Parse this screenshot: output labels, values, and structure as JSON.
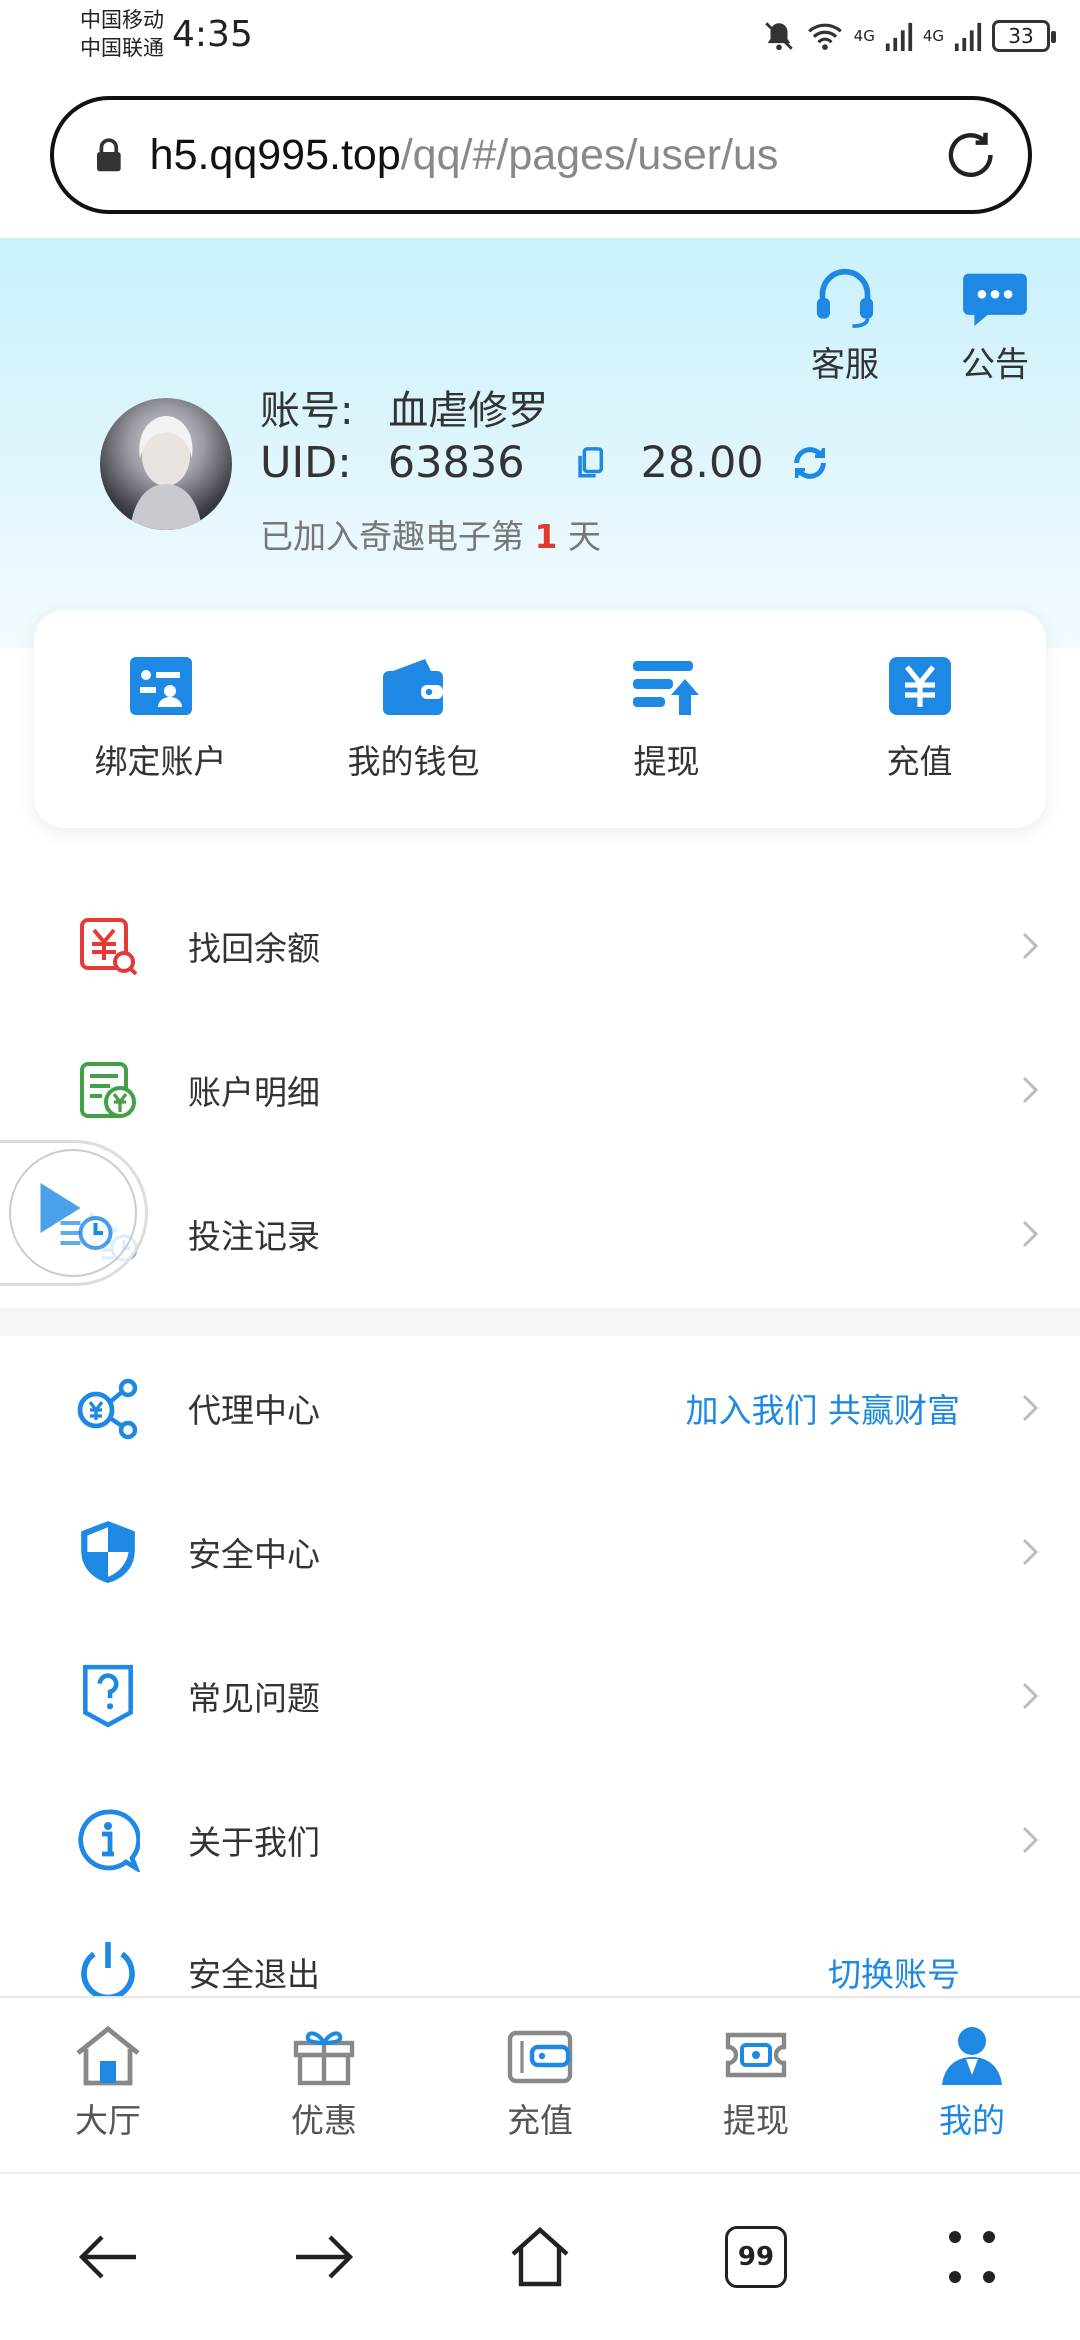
{
  "status_bar": {
    "carrier1": "中国移动",
    "carrier2": "中国联通",
    "time": "4:35",
    "signal1": "4G",
    "signal2": "4G",
    "battery": "33"
  },
  "browser": {
    "url_host": "h5.qq995.top",
    "url_path": "/qq/#/pages/user/us"
  },
  "header": {
    "service_label": "客服",
    "notice_label": "公告",
    "account_label": "账号:",
    "account_name": "血虐修罗",
    "uid_label": "UID:",
    "uid_value": "63836",
    "balance": "28.00",
    "joined_prefix": "已加入奇趣电子第",
    "joined_days": "1",
    "joined_suffix": "天"
  },
  "quick_actions": [
    {
      "label": "绑定账户",
      "icon": "bind-account-icon"
    },
    {
      "label": "我的钱包",
      "icon": "wallet-icon"
    },
    {
      "label": "提现",
      "icon": "withdraw-icon"
    },
    {
      "label": "充值",
      "icon": "recharge-icon"
    }
  ],
  "menu": [
    {
      "label": "找回余额",
      "icon": "recover-balance-icon",
      "extra": ""
    },
    {
      "label": "账户明细",
      "icon": "account-details-icon",
      "extra": ""
    },
    {
      "label": "投注记录",
      "icon": "bet-record-icon",
      "extra": ""
    },
    {
      "label": "代理中心",
      "icon": "agent-icon",
      "extra": "加入我们 共赢财富"
    },
    {
      "label": "安全中心",
      "icon": "shield-icon",
      "extra": ""
    },
    {
      "label": "常见问题",
      "icon": "faq-icon",
      "extra": ""
    },
    {
      "label": "关于我们",
      "icon": "info-icon",
      "extra": ""
    },
    {
      "label": "安全退出",
      "icon": "power-icon",
      "extra": "切换账号"
    }
  ],
  "tabbar": [
    {
      "label": "大厅",
      "icon": "home-icon",
      "active": false
    },
    {
      "label": "优惠",
      "icon": "gift-icon",
      "active": false
    },
    {
      "label": "充值",
      "icon": "recharge-tab-icon",
      "active": false
    },
    {
      "label": "提现",
      "icon": "withdraw-tab-icon",
      "active": false
    },
    {
      "label": "我的",
      "icon": "user-icon",
      "active": true
    }
  ],
  "system_nav": {
    "tabs_count": "99"
  },
  "colors": {
    "accent": "#1e88e5",
    "highlight": "#e03a2f",
    "header_bg": "#c9f1fb"
  }
}
